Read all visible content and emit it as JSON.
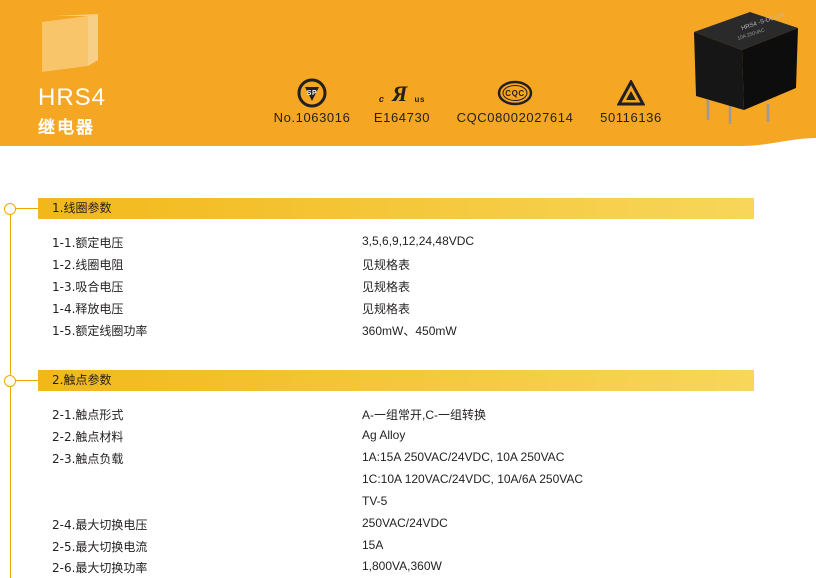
{
  "header": {
    "model": "HRS4",
    "subtitle": "继电器",
    "colors": {
      "orange": "#f5a623",
      "bar": "#f2b81a"
    },
    "certs": [
      {
        "icon": "csa-icon",
        "number": "No.1063016"
      },
      {
        "icon": "ul-icon",
        "number": "E164730"
      },
      {
        "icon": "cqc-icon",
        "number": "CQC08002027614"
      },
      {
        "icon": "tuv-icon",
        "number": "50116136"
      }
    ],
    "ul_small": {
      "c": "c",
      "us": "us"
    },
    "cqc_text": "CQC"
  },
  "sections": [
    {
      "title": "1.线圈参数",
      "rows": [
        {
          "label": "1-1.额定电压",
          "values": [
            "3,5,6,9,12,24,48VDC"
          ]
        },
        {
          "label": "1-2.线圈电阻",
          "values": [
            "见规格表"
          ]
        },
        {
          "label": "1-3.吸合电压",
          "values": [
            "见规格表"
          ]
        },
        {
          "label": "1-4.释放电压",
          "values": [
            "见规格表"
          ]
        },
        {
          "label": "1-5.额定线圈功率",
          "values": [
            "360mW、450mW"
          ]
        }
      ]
    },
    {
      "title": "2.触点参数",
      "rows": [
        {
          "label": "2-1.触点形式",
          "values": [
            "A-一组常开,C-一组转换"
          ]
        },
        {
          "label": "2-2.触点材料",
          "values": [
            "Ag Alloy"
          ]
        },
        {
          "label": "2-3.触点负载",
          "values": [
            "1A:15A 250VAC/24VDC, 10A 250VAC",
            "1C:10A 120VAC/24VDC, 10A/6A 250VAC",
            "TV-5"
          ]
        },
        {
          "label": "2-4.最大切换电压",
          "values": [
            "250VAC/24VDC"
          ]
        },
        {
          "label": "2-5.最大切换电流",
          "values": [
            "15A"
          ]
        },
        {
          "label": "2-6.最大切换功率",
          "values": [
            "1,800VA,360W"
          ]
        }
      ]
    }
  ]
}
